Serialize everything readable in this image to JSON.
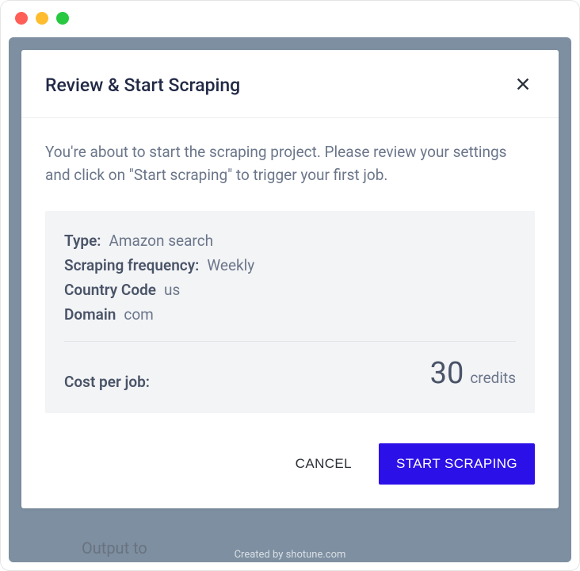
{
  "modal": {
    "title": "Review & Start Scraping",
    "intro": "You're about to start the scraping project. Please review your settings and click on \"Start scraping\" to trigger your first job.",
    "fields": {
      "type_label": "Type:",
      "type_value": "Amazon search",
      "frequency_label": "Scraping frequency:",
      "frequency_value": "Weekly",
      "country_label": "Country Code",
      "country_value": "us",
      "domain_label": "Domain",
      "domain_value": "com"
    },
    "cost": {
      "label": "Cost per job:",
      "value": "30",
      "unit": "credits"
    },
    "buttons": {
      "cancel": "CANCEL",
      "start": "START SCRAPING"
    }
  },
  "background": {
    "hidden_text": "Output to"
  },
  "watermark": "Created by shotune.com"
}
